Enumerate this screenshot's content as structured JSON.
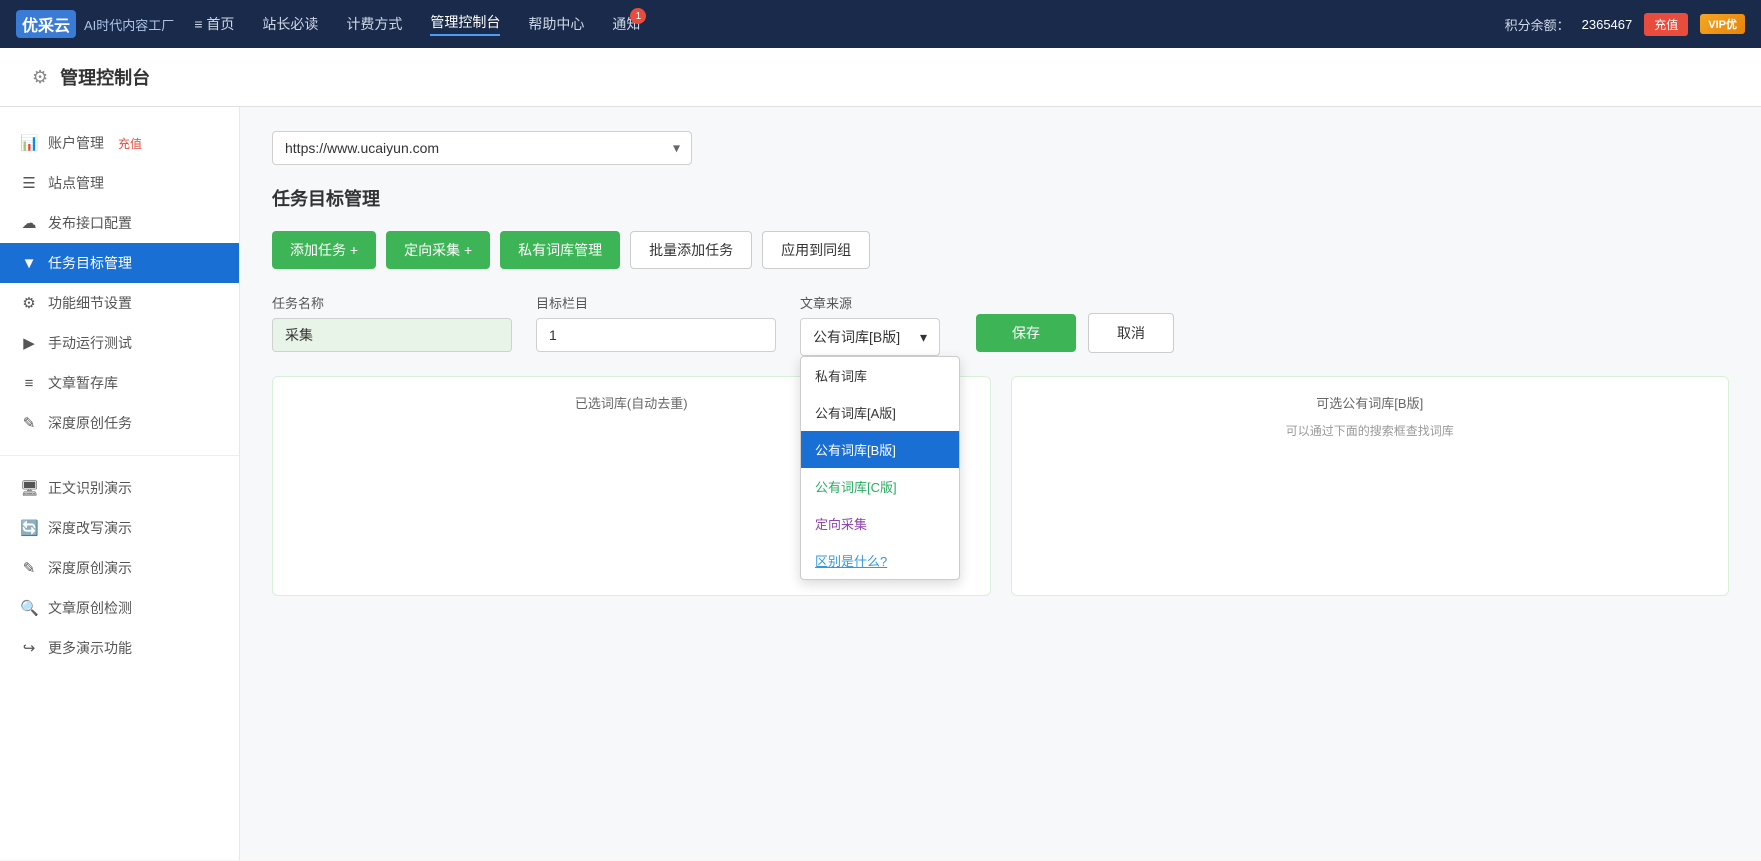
{
  "topNav": {
    "logo": {
      "box": "优采云",
      "tagline": "AI时代内容工厂"
    },
    "items": [
      {
        "label": "≡ 首页",
        "active": false
      },
      {
        "label": "站长必读",
        "active": false
      },
      {
        "label": "计费方式",
        "active": false
      },
      {
        "label": "管理控制台",
        "active": true
      },
      {
        "label": "帮助中心",
        "active": false
      },
      {
        "label": "通知",
        "active": false
      }
    ],
    "notifCount": "1",
    "pointsLabel": "积分余额：",
    "pointsValue": "2365467",
    "rechargeLabel": "充值",
    "vipLabel": "VIP优"
  },
  "pageHeader": {
    "icon": "⚙",
    "title": "管理控制台"
  },
  "sidebar": {
    "items": [
      {
        "icon": "📊",
        "label": "账户管理",
        "recharge": "充值",
        "active": false,
        "key": "account"
      },
      {
        "icon": "☰",
        "label": "站点管理",
        "active": false,
        "key": "site"
      },
      {
        "icon": "☁",
        "label": "发布接口配置",
        "active": false,
        "key": "publish"
      },
      {
        "icon": "▼",
        "label": "任务目标管理",
        "active": true,
        "key": "task"
      },
      {
        "icon": "⚙",
        "label": "功能细节设置",
        "active": false,
        "key": "settings"
      },
      {
        "icon": "▶",
        "label": "手动运行测试",
        "active": false,
        "key": "manual"
      },
      {
        "icon": "≡",
        "label": "文章暂存库",
        "active": false,
        "key": "draft"
      },
      {
        "icon": "✎",
        "label": "深度原创任务",
        "active": false,
        "key": "original"
      }
    ],
    "demoItems": [
      {
        "icon": "🖥",
        "label": "正文识别演示",
        "key": "demo1"
      },
      {
        "icon": "🔄",
        "label": "深度改写演示",
        "key": "demo2"
      },
      {
        "icon": "✎",
        "label": "深度原创演示",
        "key": "demo3"
      },
      {
        "icon": "🔍",
        "label": "文章原创检测",
        "key": "demo4"
      },
      {
        "icon": "↪",
        "label": "更多演示功能",
        "key": "demo5"
      }
    ]
  },
  "content": {
    "urlValue": "https://www.ucaiyun.com",
    "sectionTitle": "任务目标管理",
    "toolbar": {
      "addTask": "添加任务 +",
      "directedCollect": "定向采集 +",
      "privateLibMgr": "私有词库管理",
      "batchAdd": "批量添加任务",
      "applyGroup": "应用到同组"
    },
    "form": {
      "taskNameLabel": "任务名称",
      "taskNameValue": "采集",
      "targetColLabel": "目标栏目",
      "targetColValue": "1",
      "sourceLabel": "文章来源",
      "sourceSelected": "公有词库[B版]",
      "saveLabel": "保存",
      "cancelLabel": "取消"
    },
    "sourceOptions": [
      {
        "label": "私有词库",
        "type": "normal",
        "selected": false
      },
      {
        "label": "公有词库[A版]",
        "type": "normal",
        "selected": false
      },
      {
        "label": "公有词库[B版]",
        "type": "normal",
        "selected": true
      },
      {
        "label": "公有词库[C版]",
        "type": "green",
        "selected": false
      },
      {
        "label": "定向采集",
        "type": "purple",
        "selected": false
      },
      {
        "label": "区别是什么?",
        "type": "link",
        "selected": false
      }
    ],
    "leftPanel": {
      "title": "已选词库(自动去重)"
    },
    "rightPanel": {
      "title": "可选公有词库[B版]",
      "hint": "可以通过下面的搜索框查找词库"
    }
  }
}
